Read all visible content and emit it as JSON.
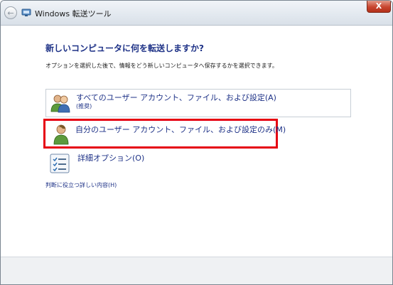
{
  "window": {
    "title": "Windows 転送ツール",
    "back_glyph": "←",
    "close_glyph": "X"
  },
  "main": {
    "heading": "新しいコンピュータに何を転送しますか?",
    "instruction": "オプションを選択した後で、情報をどう新しいコンピュータへ保存するかを選択できます。",
    "options": [
      {
        "label": "すべてのユーザー アカウント、ファイル、および設定(A)",
        "sublabel": "(推奨)",
        "icon": "multiple-users-icon"
      },
      {
        "label": "自分のユーザー アカウント、ファイル、および設定のみ(M)",
        "icon": "single-user-icon",
        "highlight_color": "#e60012"
      },
      {
        "label": "詳細オプション(O)",
        "icon": "checklist-icon"
      }
    ],
    "help_link": "判断に役立つ詳しい内容(H)"
  },
  "colors": {
    "heading": "#1e3287",
    "link": "#1e3287",
    "highlight": "#e60012"
  }
}
